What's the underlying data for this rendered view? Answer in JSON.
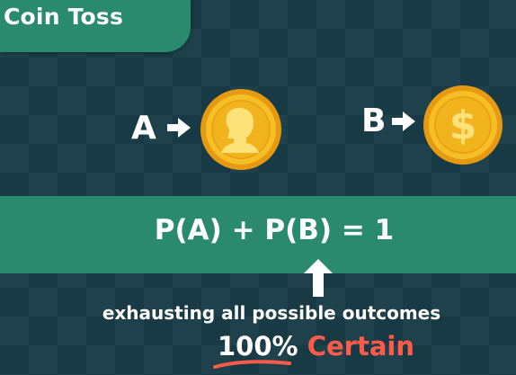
{
  "title": "Coin Toss",
  "coins": [
    {
      "label": "A",
      "face": "head-silhouette-icon"
    },
    {
      "label": "B",
      "face": "dollar-icon"
    }
  ],
  "formula": "P(A) + P(B) = 1",
  "caption": "exhausting all possible outcomes",
  "certainty": {
    "percent": "100%",
    "word": "Certain"
  },
  "colors": {
    "background": "#173a44",
    "accent_green": "#2a8a6e",
    "coin_gold": "#f2b41c",
    "certain_red": "#ff5a4a",
    "text": "#ffffff"
  }
}
